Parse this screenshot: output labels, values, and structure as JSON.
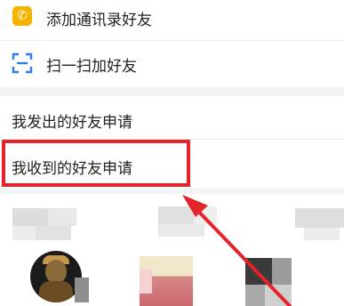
{
  "menu": {
    "add_contacts": {
      "label": "添加通讯录好友",
      "icon": "phone-icon"
    },
    "scan": {
      "label": "扫一扫加好友",
      "icon": "scan-icon"
    }
  },
  "requests": {
    "sent": {
      "label": "我发出的好友申请"
    },
    "received": {
      "label": "我收到的好友申请"
    }
  },
  "colors": {
    "highlight": "#e4232a",
    "phone_icon_bg": "#f5b300",
    "scan_icon": "#2f7be8",
    "separator": "#f2f3f5"
  }
}
